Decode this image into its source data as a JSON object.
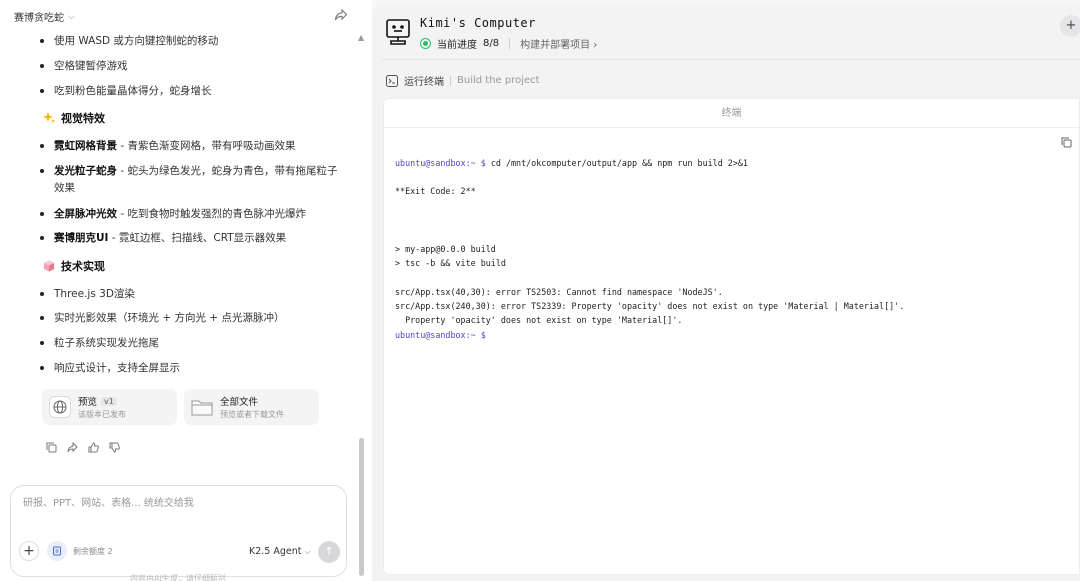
{
  "left": {
    "chat_title": "赛博贪吃蛇",
    "lines": [
      {
        "text": "使用 WASD 或方向键控制蛇的移动"
      },
      {
        "text": "空格键暂停游戏"
      },
      {
        "text": "吃到粉色能量晶体得分，蛇身增长"
      }
    ],
    "visual_section": {
      "icon": "sparkles-icon",
      "title": "视觉特效"
    },
    "visual_items": [
      {
        "bold": "霓虹网格背景",
        "rest": " - 青紫色渐变网格，带有呼吸动画效果"
      },
      {
        "bold": "发光粒子蛇身",
        "rest": " - 蛇头为绿色发光，蛇身为青色，带有拖尾粒子",
        "cont": "效果"
      },
      {
        "bold": "全屏脉冲光效",
        "rest": " - 吃到食物时触发强烈的青色脉冲光爆炸"
      },
      {
        "bold": "赛博朋克UI",
        "rest": " - 霓虹边框、扫描线、CRT显示器效果"
      }
    ],
    "tech_section": {
      "icon": "cube-icon",
      "title": "技术实现"
    },
    "tech_items": [
      "Three.js 3D渲染",
      "实时光影效果（环境光 + 方向光 + 点光源脉冲）",
      "粒子系统实现发光拖尾",
      "响应式设计，支持全屏显示"
    ],
    "cards": [
      {
        "title": "预览",
        "badge": "v1",
        "sub": "该版本已发布",
        "icon": "globe-icon"
      },
      {
        "title": "全部文件",
        "sub": "预览或者下载文件",
        "icon": "folder-icon"
      }
    ],
    "input": {
      "placeholder": "研报、PPT、网站、表格... 统统交给我",
      "quota_label": "剩余额度 2",
      "agent_label": "K2.5 Agent"
    },
    "footer": "内容由AI生成，请仔细甄别"
  },
  "right": {
    "title": "Kimi's Computer",
    "progress_label": "当前进度",
    "progress_value": "8/8",
    "build_label": "构建并部署项目",
    "step_label": "运行终端",
    "step_detail": "Build the project",
    "terminal_title": "终端",
    "terminal": {
      "prompt": "ubuntu@sandbox:~ $",
      "command": "cd /mnt/okcomputer/output/app && npm run build 2>&1",
      "exit": "**Exit Code: 2**",
      "out1": "> my-app@0.0.0 build",
      "out2": "> tsc -b && vite build",
      "err1": "src/App.tsx(40,30): error TS2503: Cannot find namespace 'NodeJS'.",
      "err2": "src/App.tsx(240,30): error TS2339: Property 'opacity' does not exist on type 'Material | Material[]'.",
      "err3": "  Property 'opacity' does not exist on type 'Material[]'.",
      "prompt2": "ubuntu@sandbox:~ $"
    }
  },
  "colors": {
    "progress_green": "#2dbd6e",
    "prompt": "#5a3fc8"
  }
}
